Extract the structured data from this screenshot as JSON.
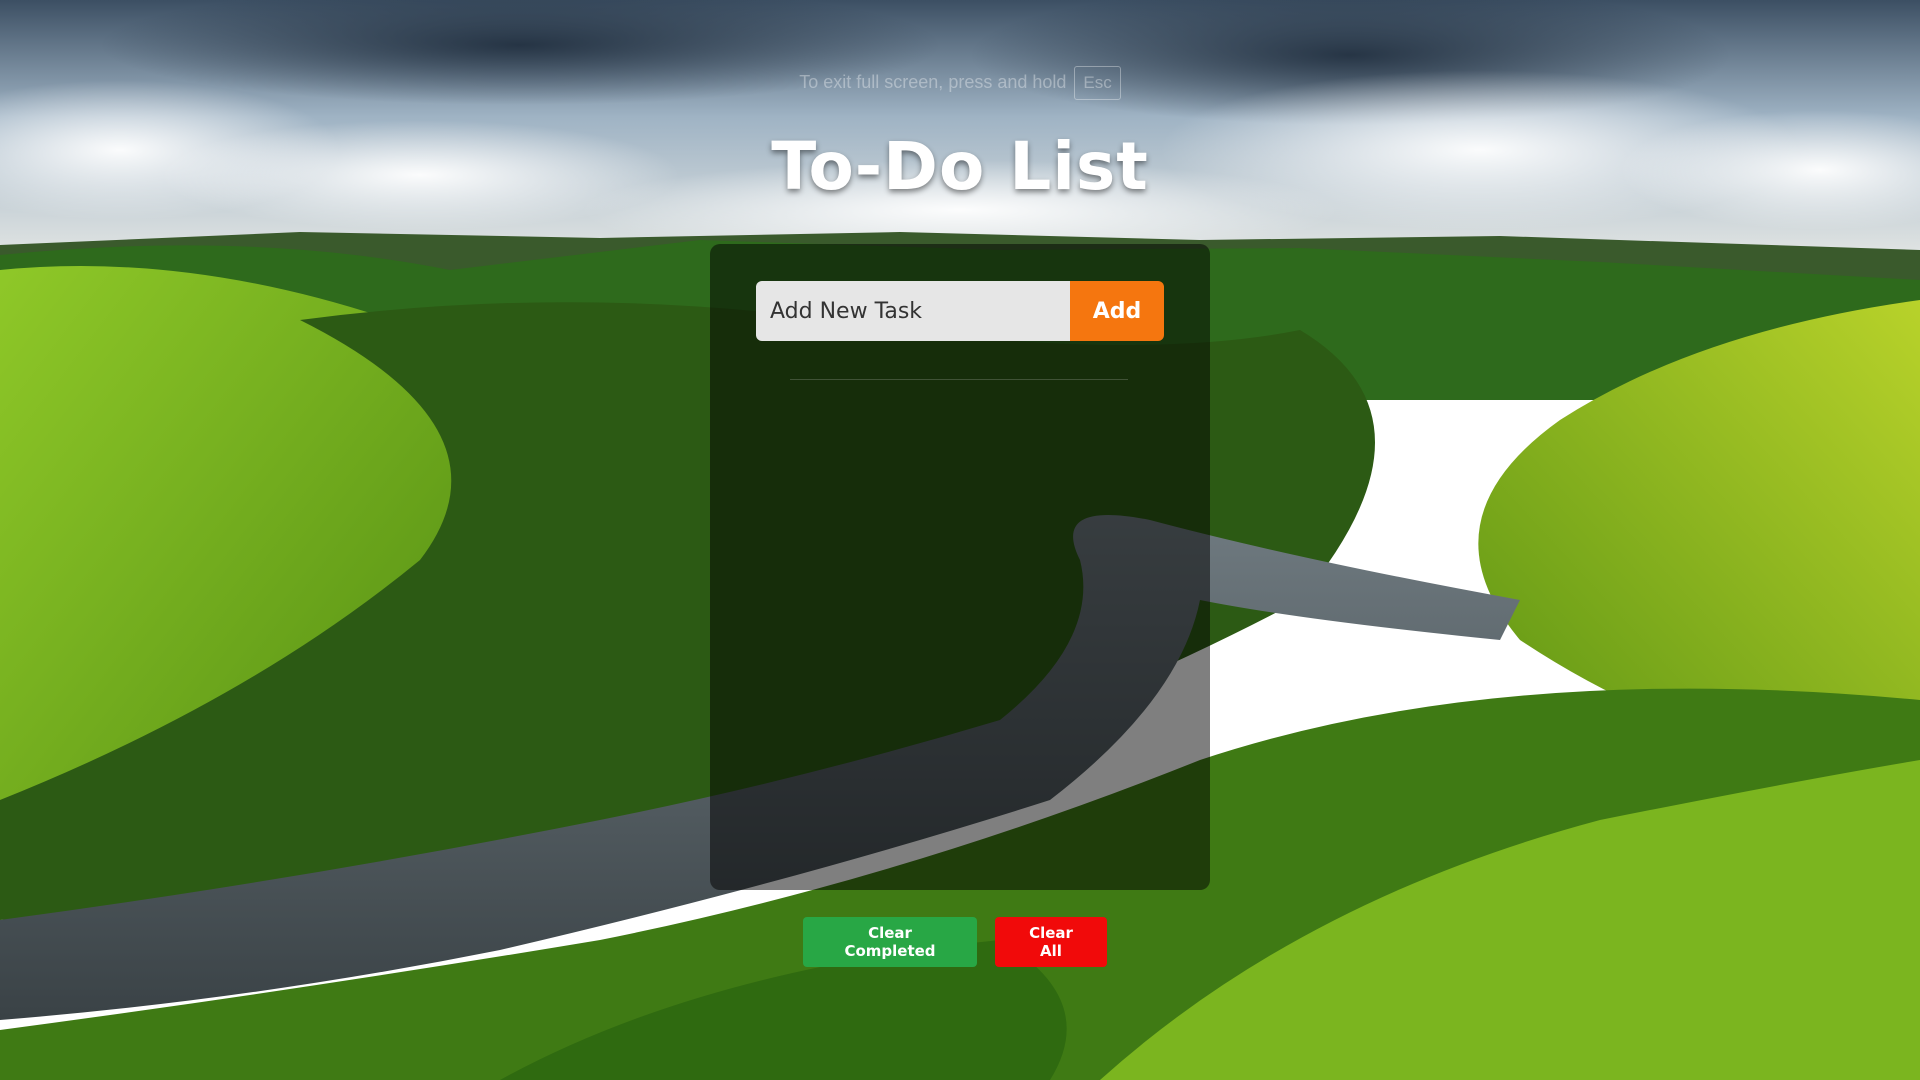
{
  "fullscreen_hint": {
    "text": "To exit full screen, press and hold",
    "key": "Esc"
  },
  "app": {
    "title": "To-Do List"
  },
  "task_input": {
    "placeholder": "Add New Task",
    "value": ""
  },
  "buttons": {
    "add_label": "Add",
    "clear_completed_label": "Clear Completed",
    "clear_all_label": "Clear All"
  },
  "tasks": [],
  "colors": {
    "add_button": "#f5760f",
    "clear_completed": "#28a745",
    "clear_all": "#f10a0a",
    "panel_overlay": "rgba(0,0,0,0.5)"
  }
}
